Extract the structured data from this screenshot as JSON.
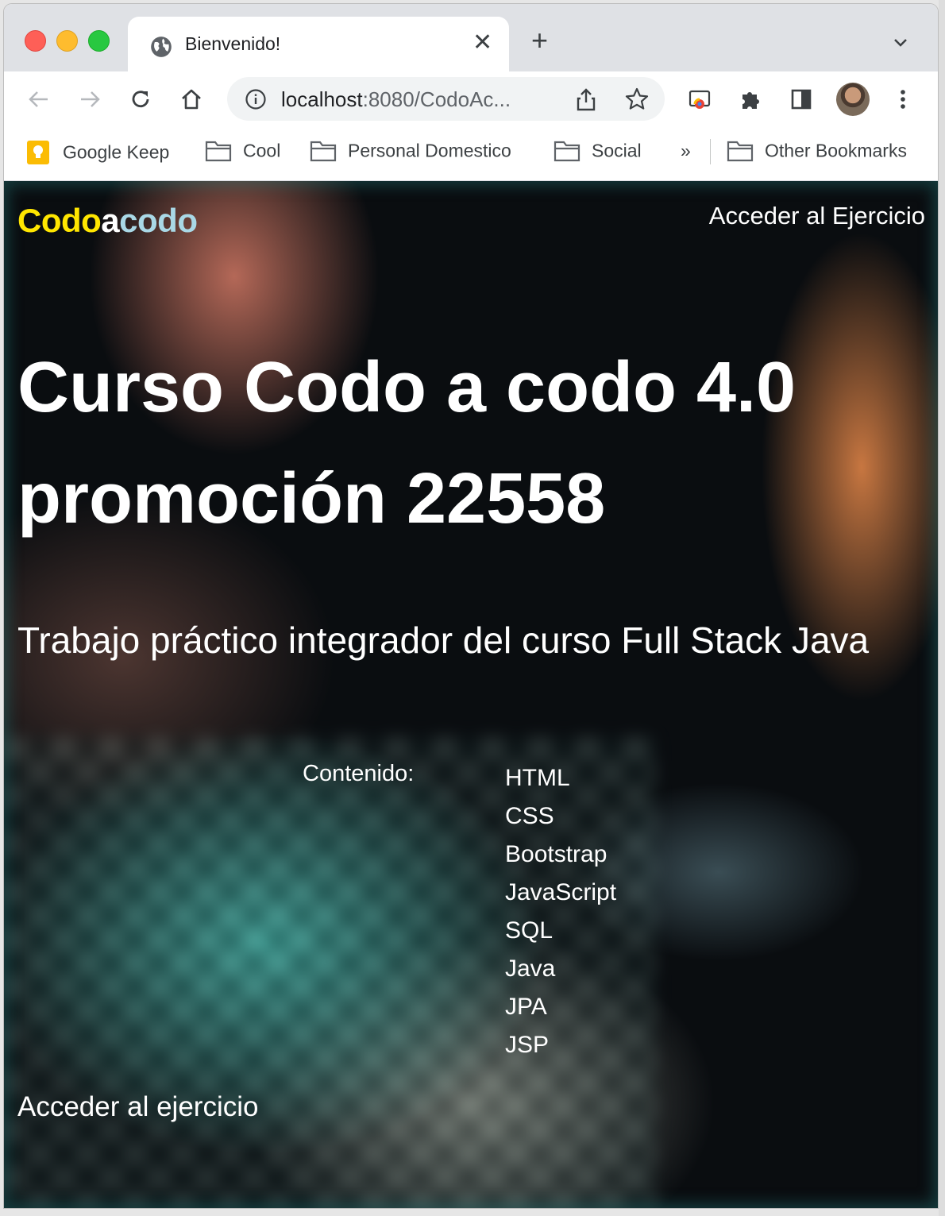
{
  "browser": {
    "tab": {
      "title": "Bienvenido!"
    },
    "address_bar": {
      "host": "localhost",
      "rest": ":8080/CodoAc..."
    },
    "bookmarks": [
      {
        "label": "Google Keep",
        "icon": "google-keep-icon"
      },
      {
        "label": "Cool",
        "icon": "folder-icon"
      },
      {
        "label": "Personal Domestico",
        "icon": "folder-icon"
      },
      {
        "label": "Social",
        "icon": "folder-icon"
      }
    ],
    "bookmarks_overflow": "»",
    "other_bookmarks": "Other Bookmarks"
  },
  "page": {
    "logo": {
      "part1": "Codo",
      "part2": "a",
      "part3": "codo"
    },
    "nav_link": "Acceder al Ejercicio",
    "title": "Curso Codo a codo 4.0 promoción 22558",
    "subtitle": "Trabajo práctico integrador del curso Full Stack Java",
    "contenido_label": "Contenido:",
    "topics": [
      "HTML",
      "CSS",
      "Bootstrap",
      "JavaScript",
      "SQL",
      "Java",
      "JPA",
      "JSP"
    ],
    "footer_link": "Acceder al ejercicio"
  },
  "colors": {
    "logo_yellow": "#ffe600",
    "logo_blue": "#a9d8e6",
    "text": "#ffffff"
  }
}
